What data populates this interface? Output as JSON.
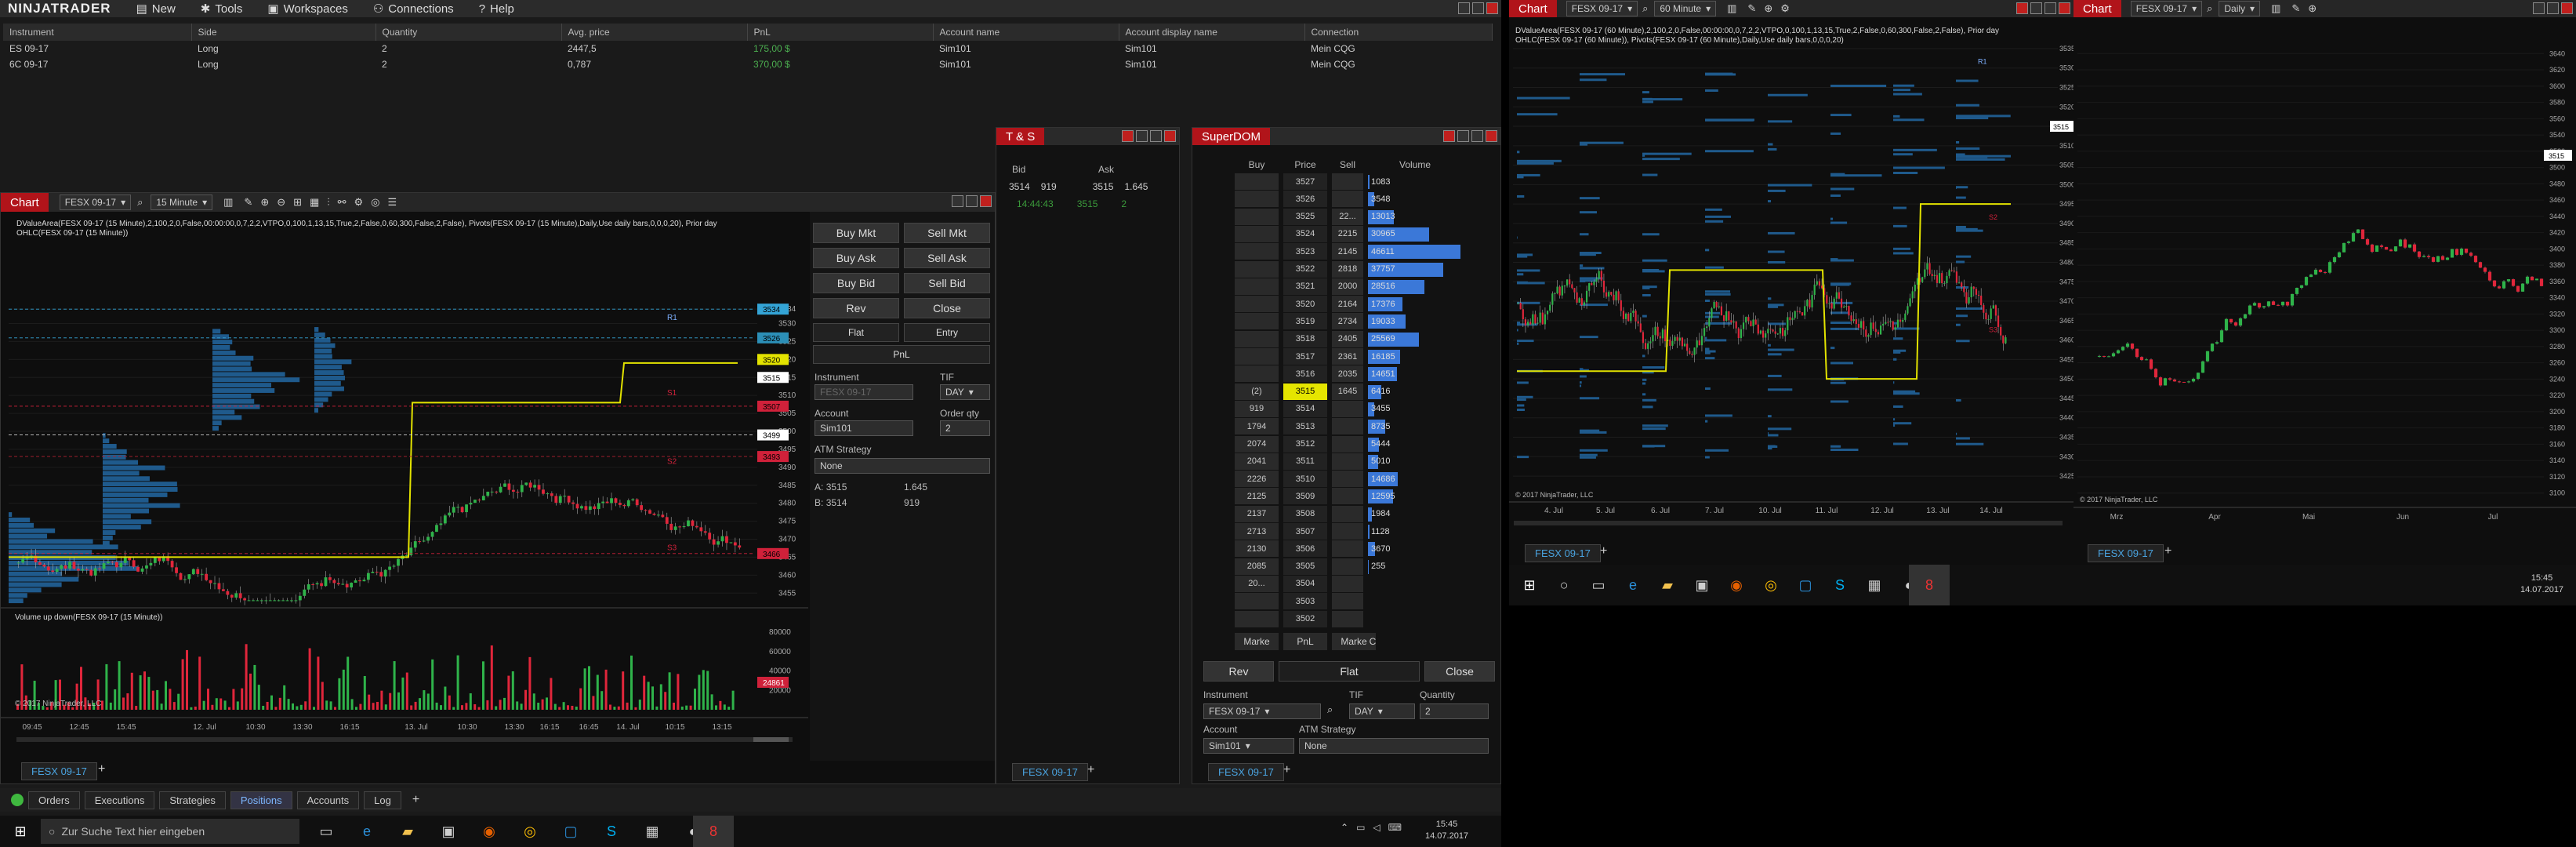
{
  "app": {
    "logo": "NINJATRADER",
    "menu": [
      "New",
      "Tools",
      "Workspaces",
      "Connections",
      "Help"
    ]
  },
  "positions": {
    "headers": [
      "Instrument",
      "Side",
      "Quantity",
      "Avg. price",
      "PnL",
      "Account name",
      "Account display name",
      "Connection"
    ],
    "rows": [
      [
        "ES 09-17",
        "Long",
        "2",
        "2447,5",
        "175,00 $",
        "Sim101",
        "Sim101",
        "Mein CQG"
      ],
      [
        "6C 09-17",
        "Long",
        "2",
        "0,787",
        "370,00 $",
        "Sim101",
        "Sim101",
        "Mein CQG"
      ]
    ]
  },
  "chart1": {
    "tab": "Chart",
    "instrument": "FESX 09-17",
    "interval": "15 Minute",
    "caption1": "DValueArea(FESX 09-17 (15 Minute),2,100,2,0,False,00:00:00,0,7,2,2,VTPO,0,100,1,13,15,True,2,False,0,60,300,False,2,False), Pivots(FESX 09-17 (15 Minute),Daily,Use daily bars,0,0,0,20), Prior day",
    "caption2": "OHLC(FESX 09-17 (15 Minute))",
    "prices": [
      "3534",
      "3530",
      "3525",
      "3520",
      "3515",
      "3510",
      "3505",
      "3500",
      "3499",
      "3495",
      "3490",
      "3485",
      "3480",
      "3475",
      "3470",
      "3465",
      "3460",
      "3455"
    ],
    "tags": [
      "3534",
      "3526",
      "3520",
      "3515",
      "3507",
      "3499",
      "3493",
      "3466"
    ],
    "levels": [
      "R1",
      "S1",
      "S2",
      "S3"
    ],
    "volcaption": "Volume up down(FESX 09-17 (15 Minute))",
    "volticks": [
      "80000",
      "60000",
      "40000",
      "20000",
      "24861"
    ],
    "copyright": "© 2017 NinjaTrader, LLC",
    "times": [
      "09:45",
      "12:45",
      "15:45",
      "12. Jul",
      "10:30",
      "13:30",
      "16:15",
      "13. Jul",
      "10:30",
      "13:30",
      "16:15",
      "16:45",
      "14. Jul",
      "10:15",
      "13:15"
    ],
    "footer_tab": "FESX 09-17"
  },
  "order": {
    "buttons": [
      "Buy Mkt",
      "Sell Mkt",
      "Buy Ask",
      "Sell Ask",
      "Buy Bid",
      "Sell Bid",
      "Rev",
      "Close",
      "Flat",
      "Entry",
      "PnL"
    ],
    "instrument_label": "Instrument",
    "tif_label": "TIF",
    "instrument": "FESX 09-17",
    "tif": "DAY",
    "account_label": "Account",
    "qty_label": "Order qty",
    "account": "Sim101",
    "qty": "2",
    "atm_label": "ATM Strategy",
    "atm": "None",
    "ask_label": "A:",
    "ask": "3515",
    "ask_size": "1.645",
    "bid_label": "B:",
    "bid": "3514",
    "bid_size": "919"
  },
  "ts": {
    "title": "T & S",
    "headers": [
      "Bid",
      "Ask"
    ],
    "row": [
      "3514",
      "919",
      "3515",
      "1.645"
    ],
    "time": "14:44:43",
    "last": "3515",
    "size": "2",
    "tab": "FESX 09-17"
  },
  "dom": {
    "title": "SuperDOM",
    "headers": [
      "Buy",
      "Price",
      "Sell",
      "Volume"
    ],
    "rows": [
      [
        "",
        "3527",
        "",
        "1083"
      ],
      [
        "",
        "3526",
        "",
        "3548"
      ],
      [
        "",
        "3525",
        "22...",
        "13013"
      ],
      [
        "",
        "3524",
        "2215",
        "30965"
      ],
      [
        "",
        "3523",
        "2145",
        "46611"
      ],
      [
        "",
        "3522",
        "2818",
        "37757"
      ],
      [
        "",
        "3521",
        "2000",
        "28516"
      ],
      [
        "",
        "3520",
        "2164",
        "17376"
      ],
      [
        "",
        "3519",
        "2734",
        "19033"
      ],
      [
        "",
        "3518",
        "2405",
        "25569"
      ],
      [
        "",
        "3517",
        "2361",
        "16185"
      ],
      [
        "",
        "3516",
        "2035",
        "14651"
      ],
      [
        "(2)",
        "3515",
        "1645",
        "6416"
      ],
      [
        "919",
        "3514",
        "",
        "3455"
      ],
      [
        "1794",
        "3513",
        "",
        "8735"
      ],
      [
        "2074",
        "3512",
        "",
        "5444"
      ],
      [
        "2041",
        "3511",
        "",
        "5010"
      ],
      [
        "2226",
        "3510",
        "",
        "14686"
      ],
      [
        "2125",
        "3509",
        "",
        "12595"
      ],
      [
        "2137",
        "3508",
        "",
        "1984"
      ],
      [
        "2713",
        "3507",
        "",
        "1128"
      ],
      [
        "2130",
        "3506",
        "",
        "3670"
      ],
      [
        "2085",
        "3505",
        "",
        "255"
      ],
      [
        "20...",
        "3504",
        "",
        ""
      ],
      [
        "",
        "3503",
        "",
        ""
      ],
      [
        "",
        "3502",
        "",
        ""
      ]
    ],
    "volfrac": [
      0.02,
      0.07,
      0.28,
      0.66,
      1.0,
      0.81,
      0.61,
      0.37,
      0.41,
      0.55,
      0.35,
      0.31,
      0.14,
      0.07,
      0.19,
      0.12,
      0.11,
      0.32,
      0.27,
      0.04,
      0.02,
      0.08,
      0.01,
      0,
      0,
      0
    ],
    "bottom": [
      "Marke",
      "PnL",
      "Marke",
      "C"
    ],
    "rev": "Rev",
    "flat": "Flat",
    "close": "Close",
    "instrument_label": "Instrument",
    "tif_label": "TIF",
    "qty_label": "Quantity",
    "instrument": "FESX 09-17",
    "tif": "DAY",
    "qty": "2",
    "account_label": "Account",
    "atm_label": "ATM Strategy",
    "account": "Sim101",
    "atm": "None",
    "tab": "FESX 09-17"
  },
  "bottomtabs": [
    "Orders",
    "Executions",
    "Strategies",
    "Positions",
    "Accounts",
    "Log"
  ],
  "taskbar1": {
    "search": "Zur Suche Text hier eingeben",
    "time": "15:45",
    "date": "14.07.2017"
  },
  "chart2": {
    "tab": "Chart",
    "instrument": "FESX 09-17",
    "interval": "60 Minute",
    "caption1": "DValueArea(FESX 09-17 (60 Minute),2,100,2,0,False,00:00:00,0,7,2,2,VTPO,0,100,1,13,15,True,2,False,0,60,300,False,2,False), Prior day",
    "caption2": "OHLC(FESX 09-17 (60 Minute)), Pivots(FESX 09-17 (60 Minute),Daily,Use daily bars,0,0,0,20)",
    "prices": [
      "3535",
      "3530",
      "3525",
      "3520",
      "3515",
      "3510",
      "3505",
      "3500",
      "3495",
      "3490",
      "3485",
      "3480",
      "3475",
      "3470",
      "3465",
      "3460",
      "3455",
      "3450",
      "3445",
      "3440",
      "3435",
      "3430",
      "3425"
    ],
    "tag": "3515",
    "levels": [
      "R1",
      "S2",
      "S3"
    ],
    "dates": [
      "4. Jul",
      "5. Jul",
      "6. Jul",
      "7. Jul",
      "10. Jul",
      "11. Jul",
      "12. Jul",
      "13. Jul",
      "14. Jul"
    ],
    "copyright": "© 2017 NinjaTrader, LLC",
    "footer_tab": "FESX 09-17"
  },
  "chart3": {
    "tab": "Chart",
    "instrument": "FESX 09-17",
    "interval": "Daily",
    "prices": [
      "3640",
      "3620",
      "3600",
      "3580",
      "3560",
      "3540",
      "3520",
      "3500",
      "3480",
      "3460",
      "3440",
      "3420",
      "3400",
      "3380",
      "3360",
      "3340",
      "3320",
      "3300",
      "3280",
      "3260",
      "3240",
      "3220",
      "3200",
      "3180",
      "3160",
      "3140",
      "3120",
      "3100"
    ],
    "tag": "3515",
    "dates": [
      "Mrz",
      "Apr",
      "Mai",
      "Jun",
      "Jul"
    ],
    "copyright": "© 2017 NinjaTrader, LLC",
    "footer_tab": "FESX 09-17"
  },
  "taskbar2": {
    "time": "15:45",
    "date": "14.07.2017"
  }
}
